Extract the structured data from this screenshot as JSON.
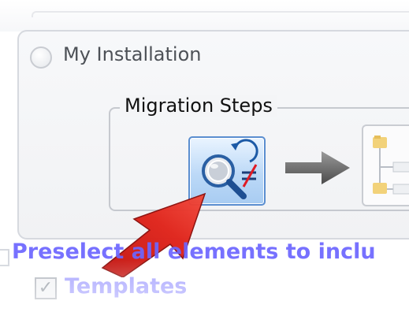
{
  "installation": {
    "radio_label": "My Installation",
    "selected": false
  },
  "migration": {
    "group_label": "Migration Steps",
    "steps": [
      {
        "icon": "compare-magnifier-icon"
      },
      {
        "icon": "hierarchy-tree-icon"
      }
    ],
    "flow_arrow_icon": "right-arrow-icon"
  },
  "annotation": {
    "icon": "red-pointer-arrow-icon",
    "color": "#e0241b"
  },
  "preselect": {
    "text": "Preselect all elements to inclu",
    "color": "#6c66ff"
  },
  "options": [
    {
      "label": "Templates",
      "checked": true
    }
  ]
}
